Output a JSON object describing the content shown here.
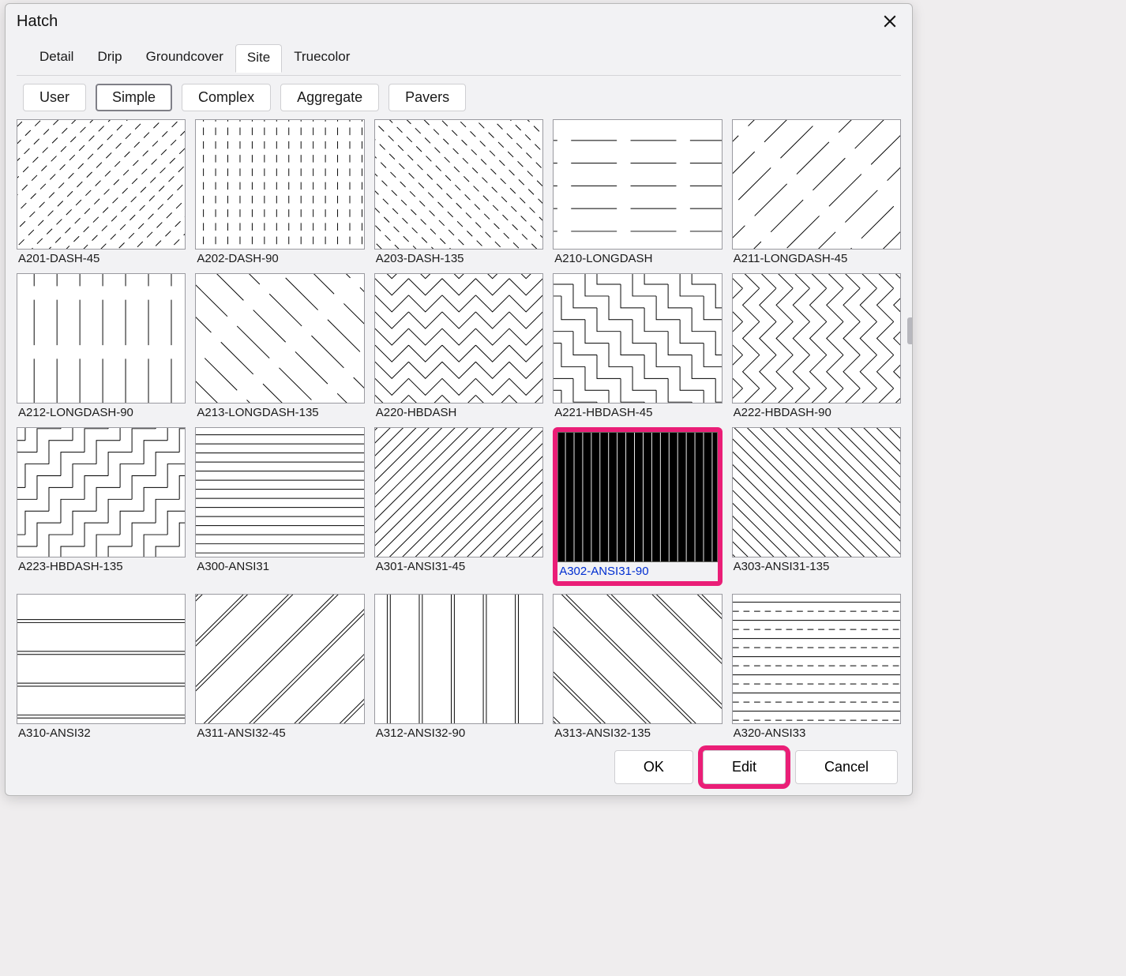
{
  "dialog": {
    "title": "Hatch"
  },
  "categories": {
    "items": [
      {
        "label": "Detail",
        "active": false
      },
      {
        "label": "Drip",
        "active": false
      },
      {
        "label": "Groundcover",
        "active": false
      },
      {
        "label": "Site",
        "active": true
      },
      {
        "label": "Truecolor",
        "active": false
      }
    ]
  },
  "filters": {
    "items": [
      {
        "label": "User",
        "active": false
      },
      {
        "label": "Simple",
        "active": true
      },
      {
        "label": "Complex",
        "active": false
      },
      {
        "label": "Aggregate",
        "active": false
      },
      {
        "label": "Pavers",
        "active": false
      }
    ]
  },
  "patterns": {
    "selected_index": 13,
    "items": [
      {
        "label": "A201-DASH-45",
        "pattern": "dash45"
      },
      {
        "label": "A202-DASH-90",
        "pattern": "dash90"
      },
      {
        "label": "A203-DASH-135",
        "pattern": "dash135"
      },
      {
        "label": "A210-LONGDASH",
        "pattern": "ldash0"
      },
      {
        "label": "A211-LONGDASH-45",
        "pattern": "ldash45"
      },
      {
        "label": "A212-LONGDASH-90",
        "pattern": "ldash90"
      },
      {
        "label": "A213-LONGDASH-135",
        "pattern": "ldash135"
      },
      {
        "label": "A220-HBDASH",
        "pattern": "hb0"
      },
      {
        "label": "A221-HBDASH-45",
        "pattern": "hb45"
      },
      {
        "label": "A222-HBDASH-90",
        "pattern": "hb90"
      },
      {
        "label": "A223-HBDASH-135",
        "pattern": "hb135"
      },
      {
        "label": "A300-ANSI31",
        "pattern": "lines0"
      },
      {
        "label": "A301-ANSI31-45",
        "pattern": "lines45"
      },
      {
        "label": "A302-ANSI31-90",
        "pattern": "lines90"
      },
      {
        "label": "A303-ANSI31-135",
        "pattern": "lines135"
      },
      {
        "label": "A310-ANSI32",
        "pattern": "pair0"
      },
      {
        "label": "A311-ANSI32-45",
        "pattern": "pair45"
      },
      {
        "label": "A312-ANSI32-90",
        "pattern": "pair90"
      },
      {
        "label": "A313-ANSI32-135",
        "pattern": "pair135"
      },
      {
        "label": "A320-ANSI33",
        "pattern": "dashsolid0"
      }
    ]
  },
  "buttons": {
    "ok": "OK",
    "edit": "Edit",
    "cancel": "Cancel"
  },
  "highlight": {
    "edit_button": true,
    "selected_cell": true
  }
}
